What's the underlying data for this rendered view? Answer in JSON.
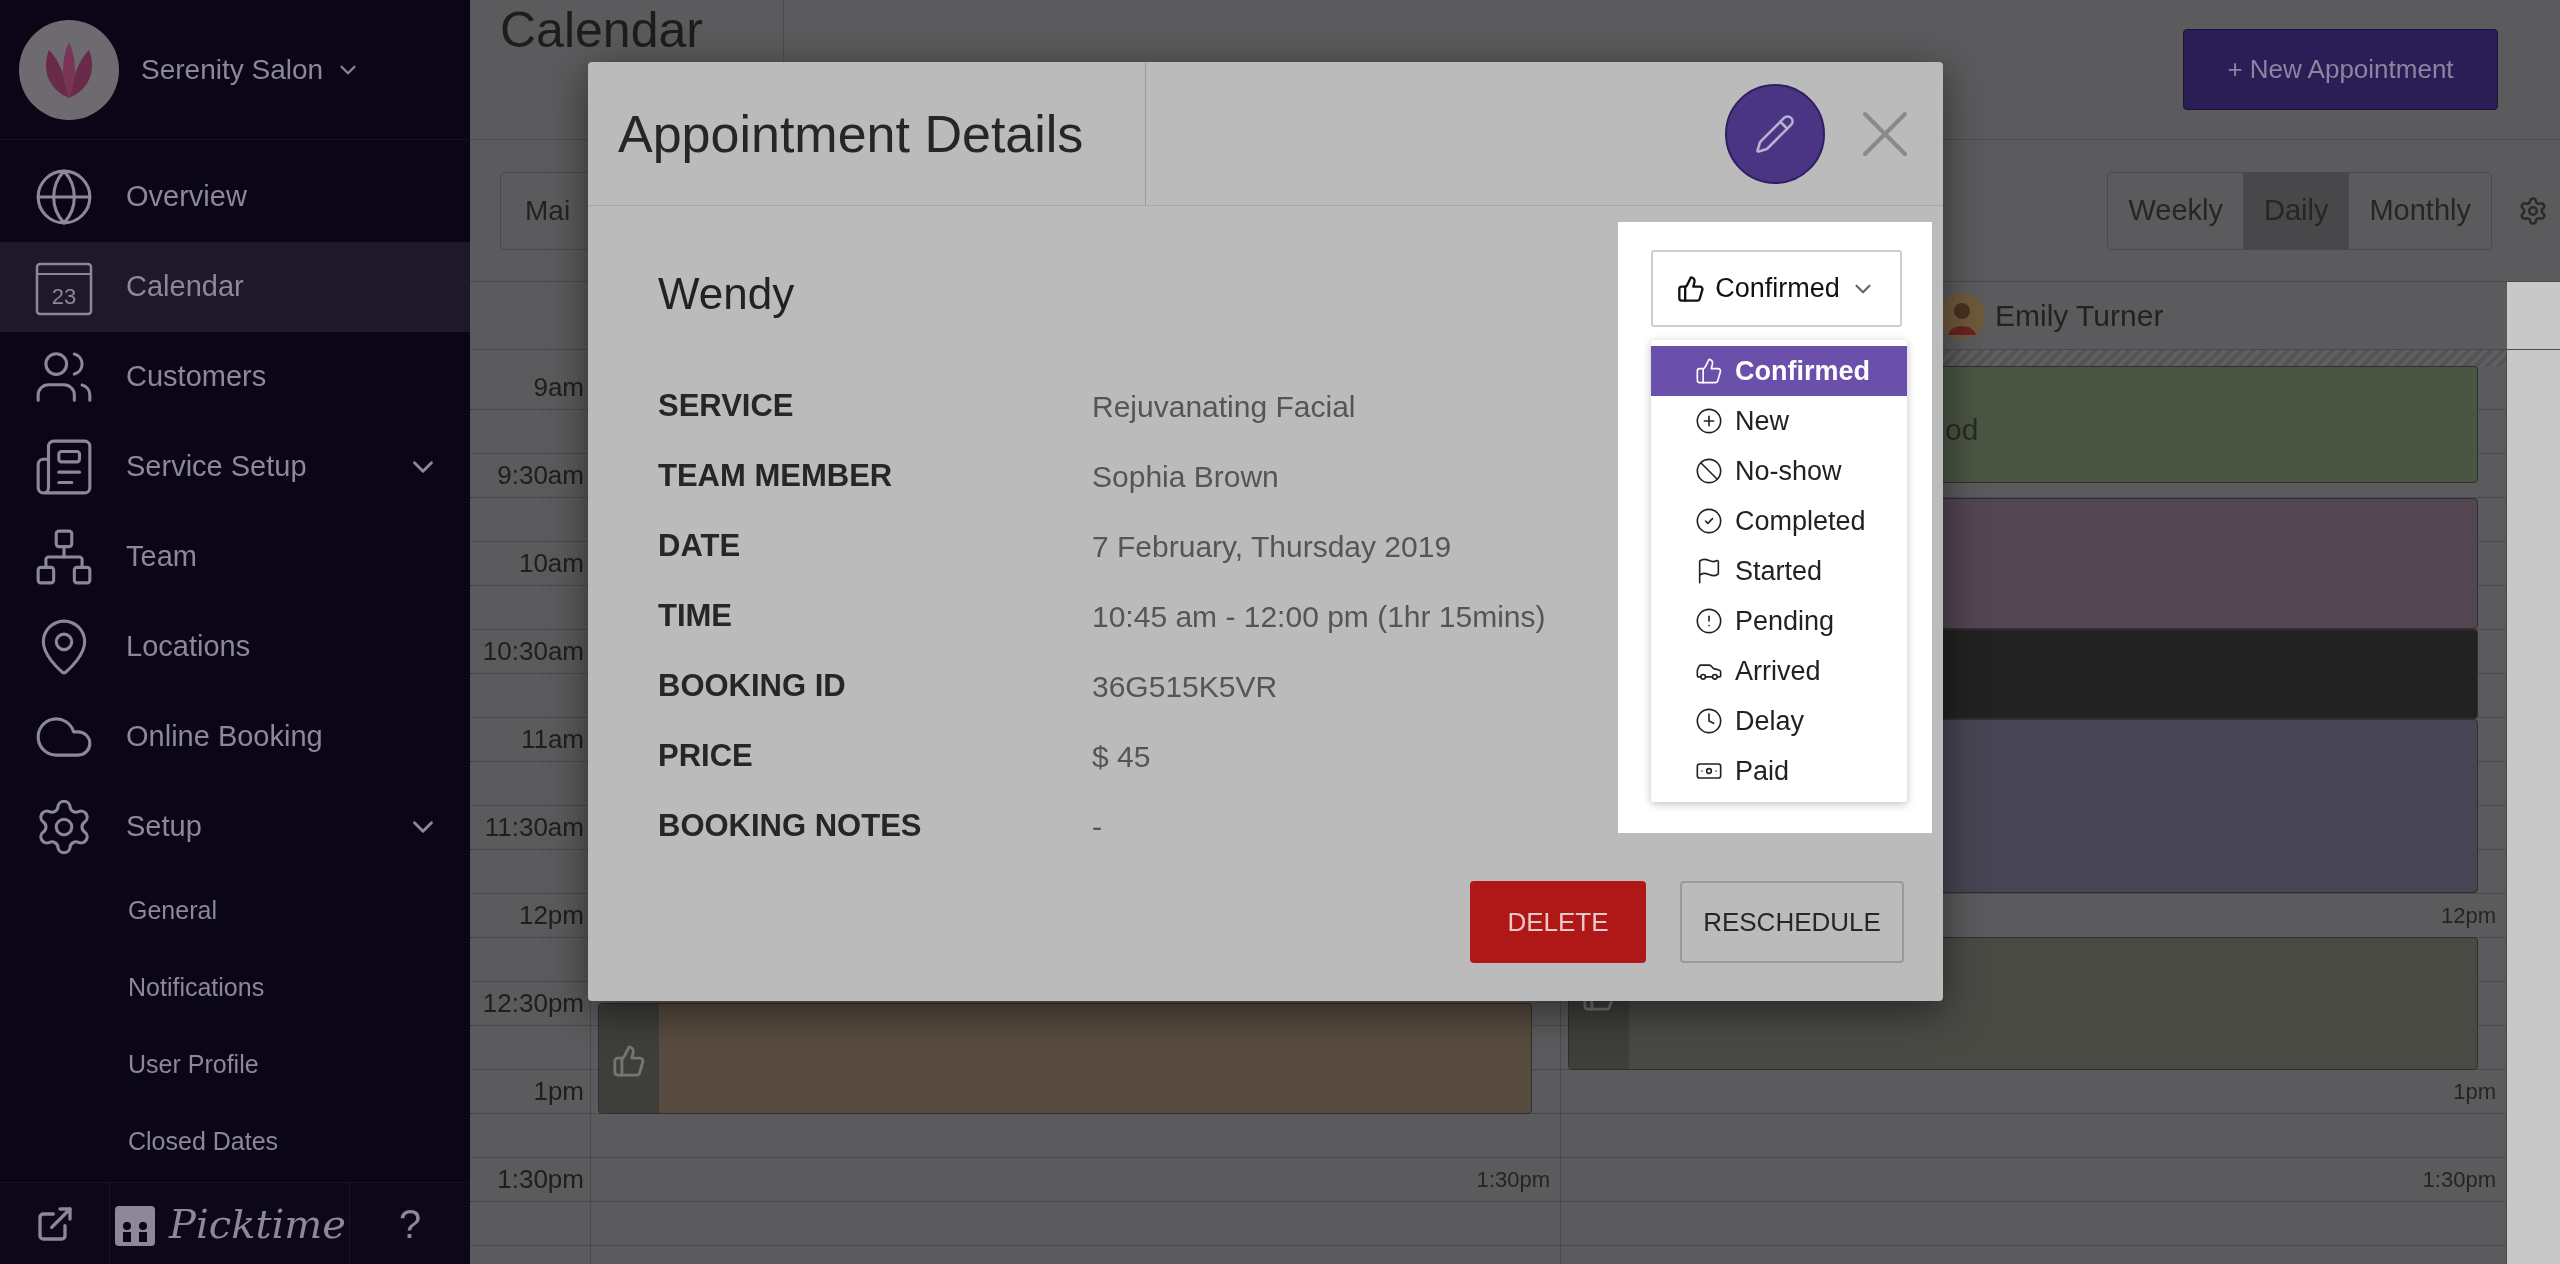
{
  "sidebar": {
    "business": "Serenity Salon",
    "items": [
      {
        "label": "Overview",
        "selected": false
      },
      {
        "label": "Calendar",
        "selected": true,
        "icon_text": "23"
      },
      {
        "label": "Customers",
        "selected": false
      },
      {
        "label": "Service Setup",
        "selected": false,
        "has_submenu": true
      },
      {
        "label": "Team",
        "selected": false
      },
      {
        "label": "Locations",
        "selected": false
      },
      {
        "label": "Online Booking",
        "selected": false
      },
      {
        "label": "Setup",
        "selected": false,
        "has_submenu": true,
        "children": [
          {
            "label": "General"
          },
          {
            "label": "Notifications"
          },
          {
            "label": "User Profile"
          },
          {
            "label": "Closed Dates"
          }
        ]
      }
    ],
    "footer": {
      "logo": "Picktime",
      "help": "?"
    }
  },
  "page": {
    "title": "Calendar",
    "new_button": "+ New Appointment",
    "location_select": "Mai",
    "views": [
      {
        "label": "Weekly",
        "selected": false
      },
      {
        "label": "Daily",
        "selected": true
      },
      {
        "label": "Monthly",
        "selected": false
      }
    ]
  },
  "calendar": {
    "staff": [
      {
        "name": "Emily Turner"
      }
    ],
    "rows": [
      {
        "time": "9am"
      },
      {
        "time": "9:30am"
      },
      {
        "time": "10am"
      },
      {
        "time": "10:30am"
      },
      {
        "time": "11am"
      },
      {
        "time": "11:30am"
      },
      {
        "time": "12pm",
        "column_2_label": "12pm"
      },
      {
        "time": "12:30pm"
      },
      {
        "time": "1pm",
        "column_2_label": "1pm"
      },
      {
        "time": "1:30pm",
        "column_1_label": "1:30pm",
        "column_2_label": "1:30pm"
      }
    ],
    "column_1_events": [
      {
        "color": "#584b3f"
      }
    ],
    "column_2_events": [
      {
        "color": "#4b5543",
        "text": "od"
      },
      {
        "color": "#534552"
      },
      {
        "color": "#222222"
      },
      {
        "color": "#474553"
      },
      {
        "color": "#4a4a45"
      }
    ]
  },
  "modal": {
    "title": "Appointment Details",
    "customer": "Wendy",
    "details": [
      {
        "label": "SERVICE",
        "value": "Rejuvanating Facial"
      },
      {
        "label": "TEAM MEMBER",
        "value": "Sophia Brown"
      },
      {
        "label": "DATE",
        "value": "7 February, Thursday 2019"
      },
      {
        "label": "TIME",
        "value": "10:45 am - 12:00 pm (1hr 15mins)"
      },
      {
        "label": "BOOKING ID",
        "value": "36G515K5VR"
      },
      {
        "label": "PRICE",
        "value": "$ 45"
      },
      {
        "label": "BOOKING NOTES",
        "value": "-"
      }
    ],
    "status": {
      "value": "Confirmed",
      "options": [
        {
          "label": "Confirmed",
          "selected": true
        },
        {
          "label": "New",
          "selected": false
        },
        {
          "label": "No-show",
          "selected": false
        },
        {
          "label": "Completed",
          "selected": false
        },
        {
          "label": "Started",
          "selected": false
        },
        {
          "label": "Pending",
          "selected": false
        },
        {
          "label": "Arrived",
          "selected": false
        },
        {
          "label": "Delay",
          "selected": false
        },
        {
          "label": "Paid",
          "selected": false
        }
      ]
    },
    "buttons": [
      {
        "label": "DELETE",
        "kind": "danger"
      },
      {
        "label": "RESCHEDULE",
        "kind": "secondary"
      }
    ]
  }
}
